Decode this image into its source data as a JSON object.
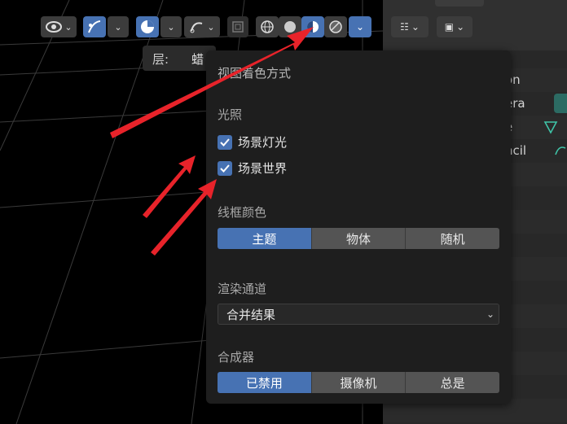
{
  "layer_bar": {
    "label": "层:",
    "value": "蜡"
  },
  "popover": {
    "title": "视图着色方式",
    "lighting": {
      "header": "光照",
      "scene_lights": {
        "label": "场景灯光",
        "checked": true
      },
      "scene_world": {
        "label": "场景世界",
        "checked": true
      }
    },
    "wireframe_color": {
      "header": "线框颜色",
      "options": [
        "主题",
        "物体",
        "随机"
      ],
      "selected": "主题"
    },
    "render_pass": {
      "header": "渲染通道",
      "value": "合并结果"
    },
    "compositor": {
      "header": "合成器",
      "options": [
        "已禁用",
        "摄像机",
        "总是"
      ],
      "selected": "已禁用"
    }
  },
  "outliner": {
    "items": [
      "on",
      "era",
      "e",
      "ncil"
    ]
  },
  "colors": {
    "accent": "#4772b3",
    "arrow": "#e8232a",
    "panel": "#1e1e1e",
    "viewport": "#000000"
  }
}
